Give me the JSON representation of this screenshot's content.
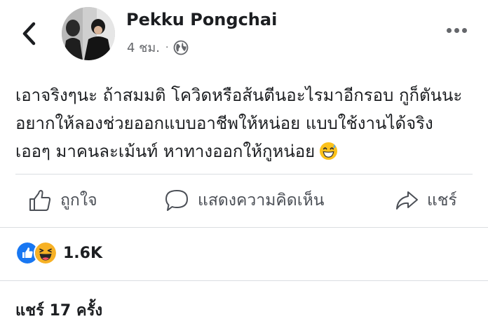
{
  "post": {
    "author": "Pekku Pongchai",
    "time": "4 ชม.",
    "separator": "·",
    "audience_icon": "globe-icon",
    "text_lines": [
      "เอาจริงๆนะ ถ้าสมมติ โควิดหรือส้นตีนอะไรมาอีกรอบ กูก็ตันนะ",
      "อยากให้ลองช่วยออกแบบอาชีพให้หน่อย แบบใช้งานได้จริง",
      "เออๆ มาคนละเม้นท์ หาทางออกให้กูหน่อย"
    ],
    "trailing_emoji": "grinning-sweat-emoji"
  },
  "actions": {
    "like_label": "ถูกใจ",
    "comment_label": "แสดงความคิดเห็น",
    "share_label": "แชร์"
  },
  "reactions": {
    "icons": [
      "like-reaction-icon",
      "haha-reaction-icon"
    ],
    "count": "1.6K"
  },
  "shares": {
    "label": "แชร์ 17 ครั้ง"
  },
  "colors": {
    "text": "#1c1e21",
    "muted": "#65676b",
    "like_blue": "#1877f2",
    "haha_yellow": "#f7b125",
    "divider": "#dadde1"
  }
}
